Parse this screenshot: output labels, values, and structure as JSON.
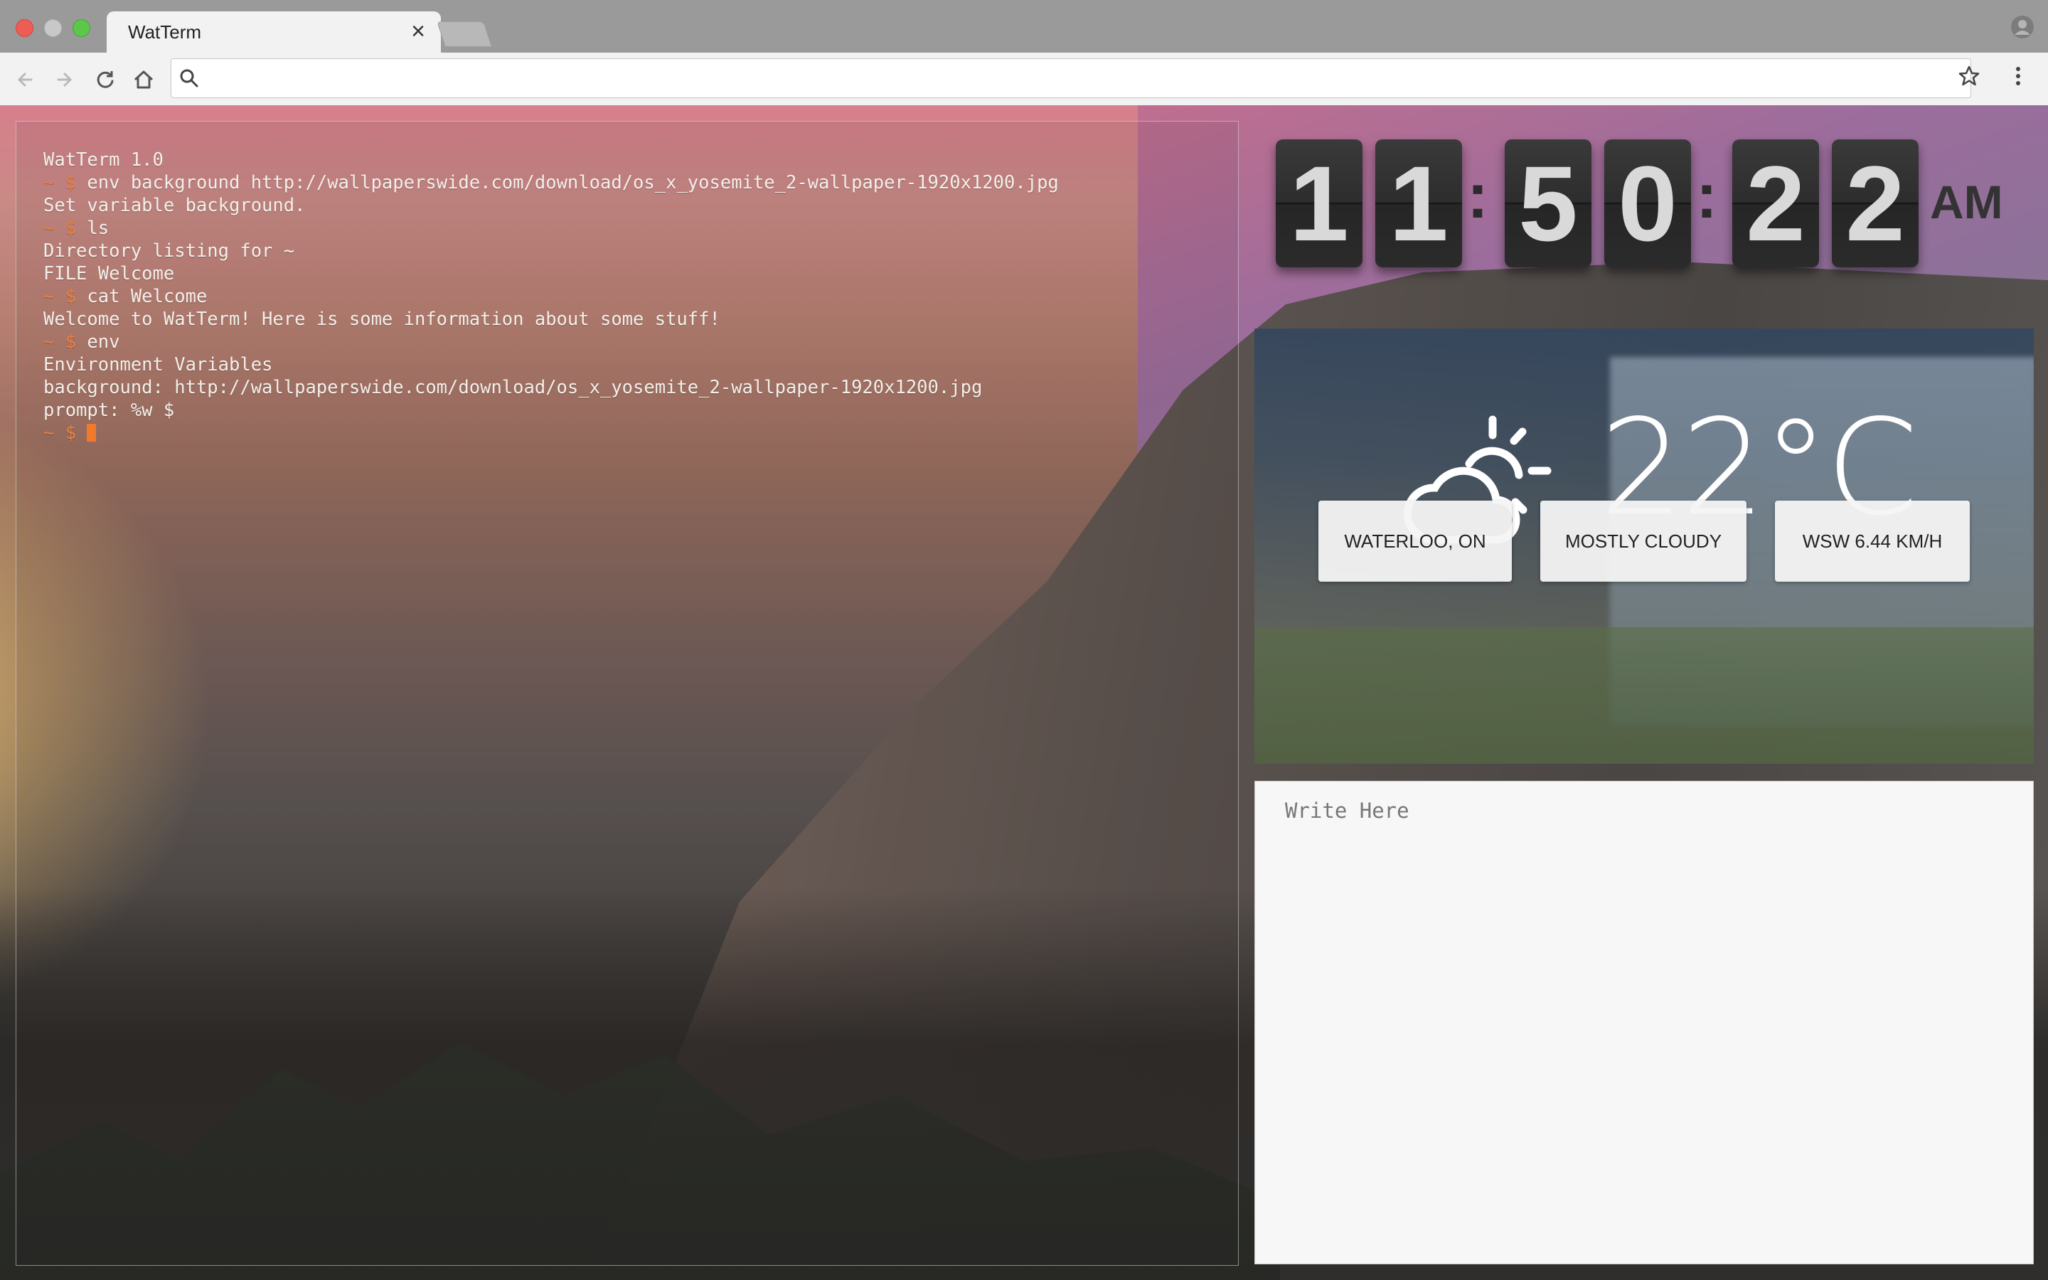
{
  "window": {
    "tab_title": "WatTerm",
    "tab_close": "×",
    "traffic_lights": [
      "#ee5d55",
      "#f5bf3a",
      "#5bc84a"
    ]
  },
  "toolbar": {
    "address_value": ""
  },
  "terminal": {
    "lines": [
      {
        "prompt": "",
        "text": "WatTerm 1.0"
      },
      {
        "prompt": "~ $",
        "text": " env background http://wallpaperswide.com/download/os_x_yosemite_2-wallpaper-1920x1200.jpg"
      },
      {
        "prompt": "",
        "text": "Set variable background."
      },
      {
        "prompt": "~ $",
        "text": " ls"
      },
      {
        "prompt": "",
        "text": "Directory listing for ~"
      },
      {
        "prompt": "",
        "text": "FILE Welcome"
      },
      {
        "prompt": "~ $",
        "text": " cat Welcome"
      },
      {
        "prompt": "",
        "text": "Welcome to WatTerm! Here is some information about some stuff!"
      },
      {
        "prompt": "~ $",
        "text": " env"
      },
      {
        "prompt": "",
        "text": "Environment Variables"
      },
      {
        "prompt": "",
        "text": "background: http://wallpaperswide.com/download/os_x_yosemite_2-wallpaper-1920x1200.jpg"
      },
      {
        "prompt": "",
        "text": "prompt: %w $"
      },
      {
        "prompt": "~ $",
        "text": " ",
        "cursor": true
      }
    ],
    "prompt_color": "#e8813f",
    "cursor_color": "#f07a2a"
  },
  "clock": {
    "h1": "1",
    "h2": "1",
    "m1": "5",
    "m2": "0",
    "s1": "2",
    "s2": "2",
    "separator": ":",
    "ampm": "AM"
  },
  "weather": {
    "icon": "partly-cloudy-icon",
    "temperature": "22°C",
    "location": "WATERLOO, ON",
    "condition": "MOSTLY CLOUDY",
    "wind": "WSW 6.44 KM/H"
  },
  "notes": {
    "placeholder": "Write Here",
    "value": ""
  }
}
